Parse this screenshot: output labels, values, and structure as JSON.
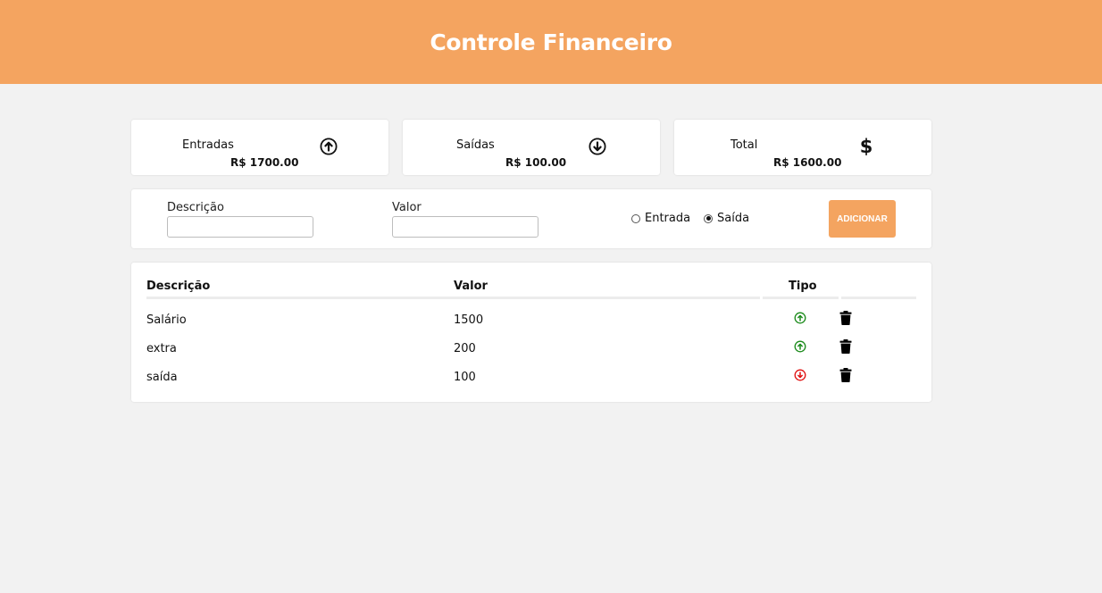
{
  "header": {
    "title": "Controle Financeiro"
  },
  "summary": [
    {
      "label": "Entradas",
      "value": "R$ 1700.00",
      "icon": "arrow-circle-up-icon"
    },
    {
      "label": "Saídas",
      "value": "R$ 100.00",
      "icon": "arrow-circle-down-icon"
    },
    {
      "label": "Total",
      "value": "R$ 1600.00",
      "icon": "dollar-icon"
    }
  ],
  "form": {
    "description_label": "Descrição",
    "description_value": "",
    "value_label": "Valor",
    "value_value": "",
    "type_options": [
      {
        "label": "Entrada",
        "checked": false
      },
      {
        "label": "Saída",
        "checked": true
      }
    ],
    "add_label": "ADICIONAR"
  },
  "table": {
    "headers": [
      "Descrição",
      "Valor",
      "Tipo"
    ],
    "rows": [
      {
        "description": "Salário",
        "value": "1500",
        "type": "entrada"
      },
      {
        "description": "extra",
        "value": "200",
        "type": "entrada"
      },
      {
        "description": "saída",
        "value": "100",
        "type": "saida"
      }
    ]
  },
  "colors": {
    "accent": "#f4a460",
    "income": "#1a8a1a",
    "expense": "#e01010",
    "background": "#f2f2f2"
  }
}
